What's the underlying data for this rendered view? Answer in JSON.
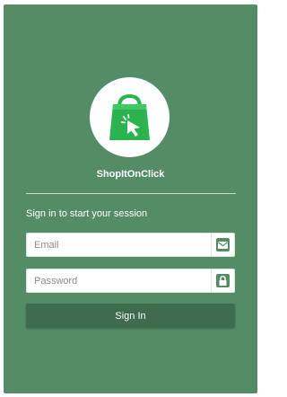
{
  "brand": {
    "name": "ShopItOnClick",
    "logo_icon": "shopping-bag-cursor-icon"
  },
  "login": {
    "subtitle": "Sign in to start your session",
    "email": {
      "placeholder": "Email",
      "value": "",
      "icon": "envelope-icon"
    },
    "password": {
      "placeholder": "Password",
      "value": "",
      "icon": "lock-icon"
    },
    "submit_label": "Sign In"
  },
  "colors": {
    "panel_bg": "#548c66",
    "button_bg": "#3f6b4e",
    "logo_green": "#2ab34e",
    "text": "#ffffff"
  }
}
